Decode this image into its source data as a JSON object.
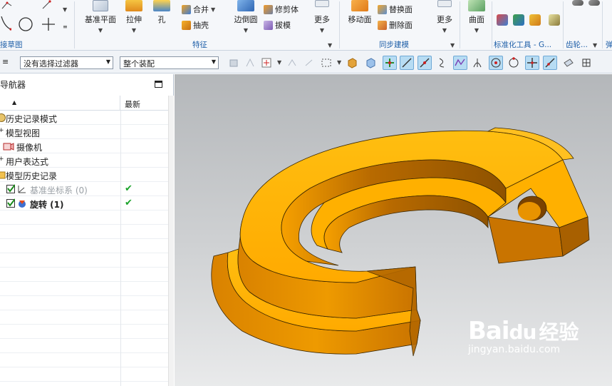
{
  "ribbon": {
    "groups": {
      "sketch_label": "接草图",
      "feature_label": "特征",
      "sync_label": "同步建模",
      "std_label": "标准化工具 - G...",
      "gear_label": "齿轮...",
      "spring_label": "弹"
    },
    "buttons": {
      "datum_plane": "基准平面",
      "extrude": "拉伸",
      "hole": "孔",
      "unite": "合并",
      "shell": "抽壳",
      "trim_body": "修剪体",
      "draft": "拔模",
      "edge_blend": "边倒圆",
      "more_feature": "更多",
      "move_face": "移动面",
      "replace_face": "替换面",
      "delete_face": "删除面",
      "more_sync": "更多",
      "surface": "曲面"
    }
  },
  "toolbar": {
    "filter_select": "没有选择过滤器",
    "scope_select": "整个装配"
  },
  "navigator": {
    "title": "导航器",
    "col_latest": "最新",
    "rows": [
      {
        "label": "历史记录模式"
      },
      {
        "label": "模型视图"
      },
      {
        "label": "摄像机"
      },
      {
        "label": "用户表达式"
      },
      {
        "label": "模型历史记录"
      },
      {
        "label": "基准坐标系 (0)",
        "latest": "✔"
      },
      {
        "label": "旋转 (1)",
        "latest": "✔"
      }
    ]
  },
  "watermark": {
    "logo_bai": "Bai",
    "logo_du": "du",
    "logo_jingyan": "经验",
    "url": "jingyan.baidu.com"
  },
  "colors": {
    "part_top": "#FFB300",
    "part_side": "#E28A00",
    "part_dark": "#A65E00",
    "accent_blue": "#1f5fa8"
  },
  "icons": [
    "arc-icon",
    "circle-icon",
    "line-icon",
    "datum-plane-icon",
    "extrude-icon",
    "hole-icon",
    "unite-icon",
    "shell-icon",
    "trim-body-icon",
    "draft-icon",
    "edge-blend-icon",
    "move-face-icon",
    "replace-face-icon",
    "delete-face-icon",
    "surface-icon",
    "green-checkmark-icon"
  ]
}
